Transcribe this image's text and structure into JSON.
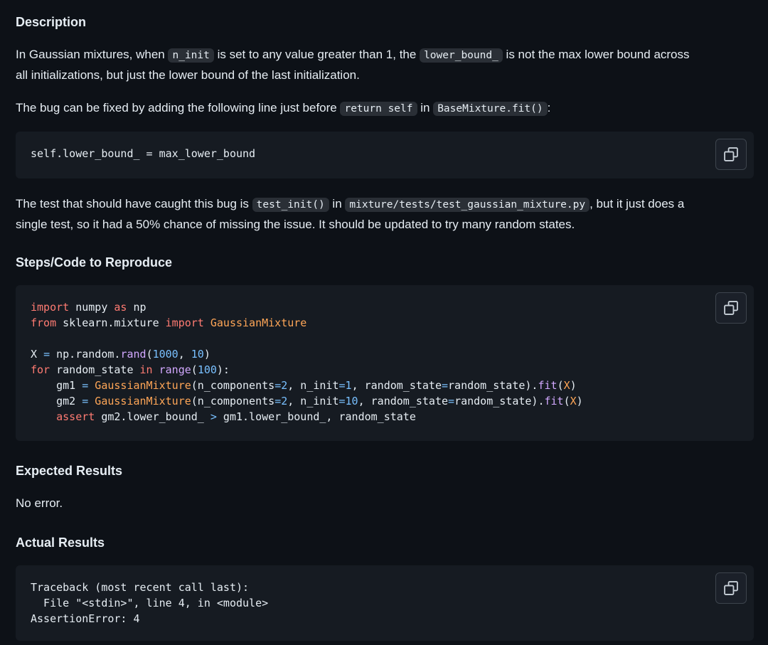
{
  "sections": {
    "description_title": "Description",
    "steps_title": "Steps/Code to Reproduce",
    "expected_title": "Expected Results",
    "actual_title": "Actual Results"
  },
  "para1": {
    "t1": "In Gaussian mixtures, when ",
    "c1": "n_init",
    "t2": " is set to any value greater than 1, the ",
    "c2": "lower_bound_",
    "t3": " is not the max lower bound across",
    "t4": "all initializations, but just the lower bound of the last initialization."
  },
  "para2": {
    "t1": "The bug can be fixed by adding the following line just before ",
    "c1": "return self",
    "t2": " in ",
    "c2": "BaseMixture.fit()",
    "t3": ":"
  },
  "code1": {
    "line": "self.lower_bound_ = max_lower_bound"
  },
  "para3": {
    "t1": "The test that should have caught this bug is ",
    "c1": "test_init()",
    "t2": " in ",
    "c2": "mixture/tests/test_gaussian_mixture.py",
    "t3": ", but it just does a",
    "t4": "single test, so it had a 50% chance of missing the issue. It should be updated to try many random states."
  },
  "code2": {
    "l1_kw1": "import",
    "l1_a": " numpy ",
    "l1_kw2": "as",
    "l1_b": " np",
    "l2_kw1": "from",
    "l2_a": " sklearn.mixture ",
    "l2_kw2": "import",
    "l2_cls": " GaussianMixture",
    "l4_a": "X ",
    "l4_eq": "=",
    "l4_b": " np.random.",
    "l4_fn": "rand",
    "l4_c": "(",
    "l4_n1": "1000",
    "l4_d": ", ",
    "l4_n2": "10",
    "l4_e": ")",
    "l5_kw1": "for",
    "l5_a": " random_state ",
    "l5_kw2": "in",
    "l5_b": " ",
    "l5_fn": "range",
    "l5_c": "(",
    "l5_n": "100",
    "l5_d": "):",
    "l6_a": "    gm1 ",
    "l6_eq": "=",
    "l6_cls": " GaussianMixture",
    "l6_b": "(n_components",
    "l6_eq2": "=",
    "l6_n1": "2",
    "l6_c": ", n_init",
    "l6_eq3": "=",
    "l6_n2": "1",
    "l6_d": ", random_state",
    "l6_eq4": "=",
    "l6_e": "random_state).",
    "l6_fn": "fit",
    "l6_f": "(",
    "l6_x": "X",
    "l6_g": ")",
    "l7_a": "    gm2 ",
    "l7_eq": "=",
    "l7_cls": " GaussianMixture",
    "l7_b": "(n_components",
    "l7_eq2": "=",
    "l7_n1": "2",
    "l7_c": ", n_init",
    "l7_eq3": "=",
    "l7_n2": "10",
    "l7_d": ", random_state",
    "l7_eq4": "=",
    "l7_e": "random_state).",
    "l7_fn": "fit",
    "l7_f": "(",
    "l7_x": "X",
    "l7_g": ")",
    "l8_sp": "    ",
    "l8_kw": "assert",
    "l8_a": " gm2.lower_bound_ ",
    "l8_gt": ">",
    "l8_b": " gm1.lower_bound_, random_state"
  },
  "expected_text": "No error.",
  "code3": {
    "l1": "Traceback (most recent call last):",
    "l2": "  File \"<stdin>\", line 4, in <module>",
    "l3": "AssertionError: 4"
  },
  "icons": {
    "copy": "copy-icon"
  },
  "colors": {
    "background": "#0d1117",
    "code_background": "#161b22",
    "inline_code_background": "#2a2f36",
    "keyword": "#ff7b72",
    "class_name": "#ffa657",
    "number": "#79c0ff",
    "function": "#d2a8ff"
  }
}
